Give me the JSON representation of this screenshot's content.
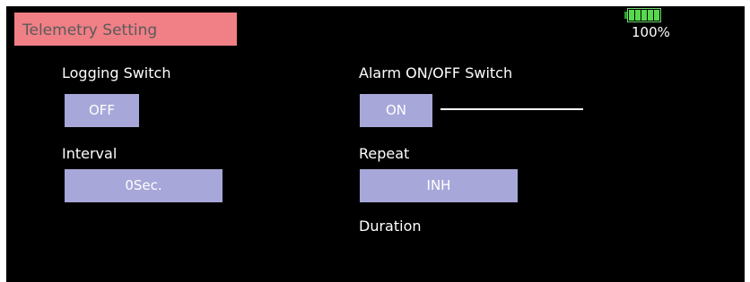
{
  "header": {
    "title": "Telemetry Setting"
  },
  "status": {
    "battery_percent_label": "100%",
    "battery_level": 1.0,
    "battery_color": "#56d94d"
  },
  "logging": {
    "label": "Logging Switch",
    "value": "OFF"
  },
  "interval": {
    "label": "Interval",
    "value": "0Sec."
  },
  "alarm": {
    "label": "Alarm ON/OFF Switch",
    "value": "ON"
  },
  "repeat": {
    "label": "Repeat",
    "value": "INH"
  },
  "duration": {
    "label": "Duration"
  },
  "colors": {
    "title_bg": "#f07f86",
    "button_bg": "#a7a7d9",
    "screen_bg": "#000000"
  }
}
